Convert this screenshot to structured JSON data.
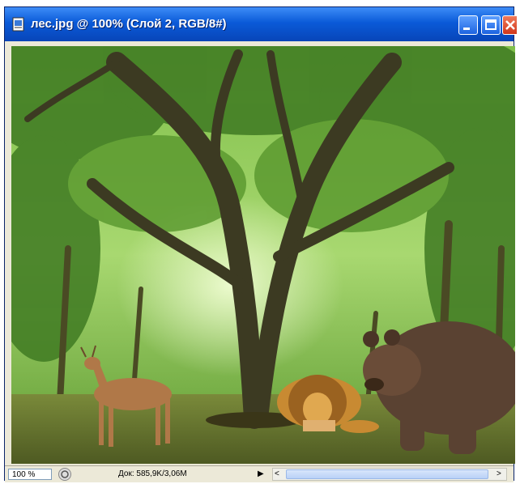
{
  "window": {
    "title": "лес.jpg @ 100% (Слой 2, RGB/8#)"
  },
  "status": {
    "zoom": "100 %",
    "doc_info": "Док: 585,9K/3,06M",
    "play_arrow": "▶",
    "scroll_left_arrow": "<",
    "scroll_right_arrow": ">"
  },
  "icons": {
    "document": "photoshop-document-icon",
    "minimize": "minimize-icon",
    "maximize": "maximize-icon",
    "close": "close-icon",
    "navigator": "navigator-icon"
  },
  "colors": {
    "titlebar": "#0a5ad8",
    "foliage": "#4f8f2a",
    "ground": "#6f6a2c"
  }
}
